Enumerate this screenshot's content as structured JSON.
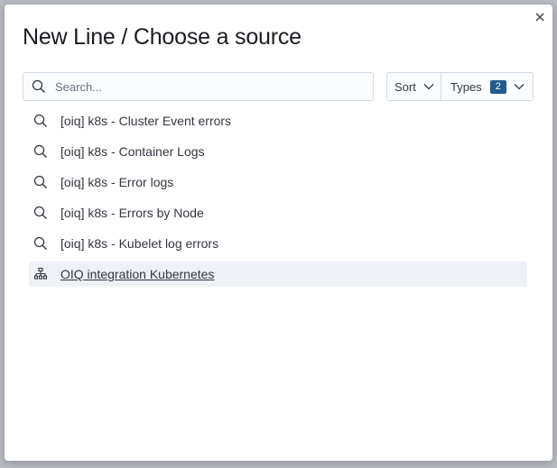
{
  "modal": {
    "title": "New Line / Choose a source",
    "close_icon": "close-icon"
  },
  "search": {
    "placeholder": "Search...",
    "value": "",
    "icon": "search-icon"
  },
  "controls": {
    "sort_label": "Sort",
    "types_label": "Types",
    "types_count": "2"
  },
  "sources": [
    {
      "label": "[oiq] k8s - Cluster Event errors",
      "icon": "search-icon"
    },
    {
      "label": "[oiq] k8s - Container Logs",
      "icon": "search-icon"
    },
    {
      "label": "[oiq] k8s - Error logs",
      "icon": "search-icon"
    },
    {
      "label": "[oiq] k8s - Errors by Node",
      "icon": "search-icon"
    },
    {
      "label": "[oiq] k8s - Kubelet log errors",
      "icon": "search-icon"
    },
    {
      "label": "OIQ integration Kubernetes",
      "icon": "index-pattern-icon",
      "selected": true
    }
  ],
  "colors": {
    "badge": "#1f5b8d",
    "selected_row": "#eef1f6"
  }
}
